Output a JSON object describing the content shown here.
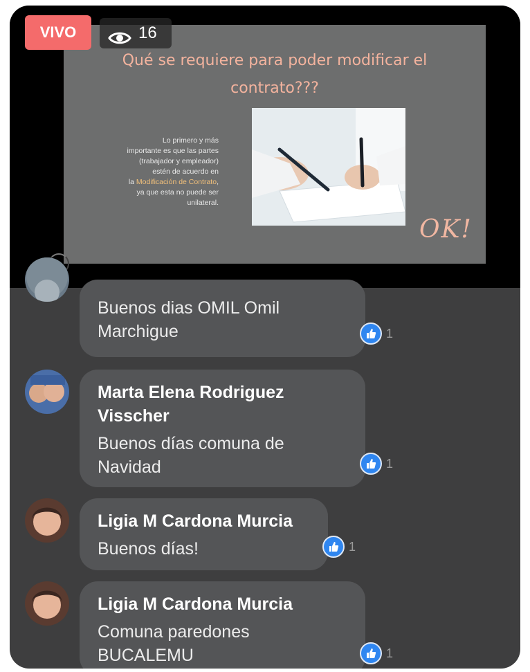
{
  "live": {
    "badge": "VIVO",
    "viewers": "16"
  },
  "slide": {
    "title_line1": "Qué se requiere para poder modificar el",
    "title_line2": "contrato???",
    "body_lines": [
      "Lo primero y más",
      "importante es que las partes",
      "(trabajador y empleador)",
      "estén de acuerdo en"
    ],
    "body_prefix": "la ",
    "body_highlight": "Modificación de Contrato",
    "body_suffix": ",",
    "body_tail": [
      "ya que esta no puede ser",
      "unilateral."
    ],
    "stamp": "OK!"
  },
  "comments": [
    {
      "author": "",
      "text_lines": [
        "Buenos dias OMIL Omil",
        "Marchigue"
      ],
      "likes": "1"
    },
    {
      "author_lines": [
        "Marta Elena Rodriguez",
        "Visscher"
      ],
      "text_lines": [
        "Buenos días comuna de",
        "Navidad"
      ],
      "likes": "1"
    },
    {
      "author_lines": [
        "Ligia M Cardona Murcia"
      ],
      "text_lines": [
        "Buenos días!"
      ],
      "likes": "1"
    },
    {
      "author_lines": [
        "Ligia M Cardona Murcia"
      ],
      "text_lines": [
        "Comuna paredones",
        "BUCALEMU"
      ],
      "likes": "1"
    }
  ],
  "colors": {
    "live_red": "#f46b6b",
    "slide_title": "#f3b39e",
    "highlight": "#f2c07a",
    "like_blue": "#2f86f0",
    "bubble": "#545557",
    "background": "#3e3e3f"
  }
}
